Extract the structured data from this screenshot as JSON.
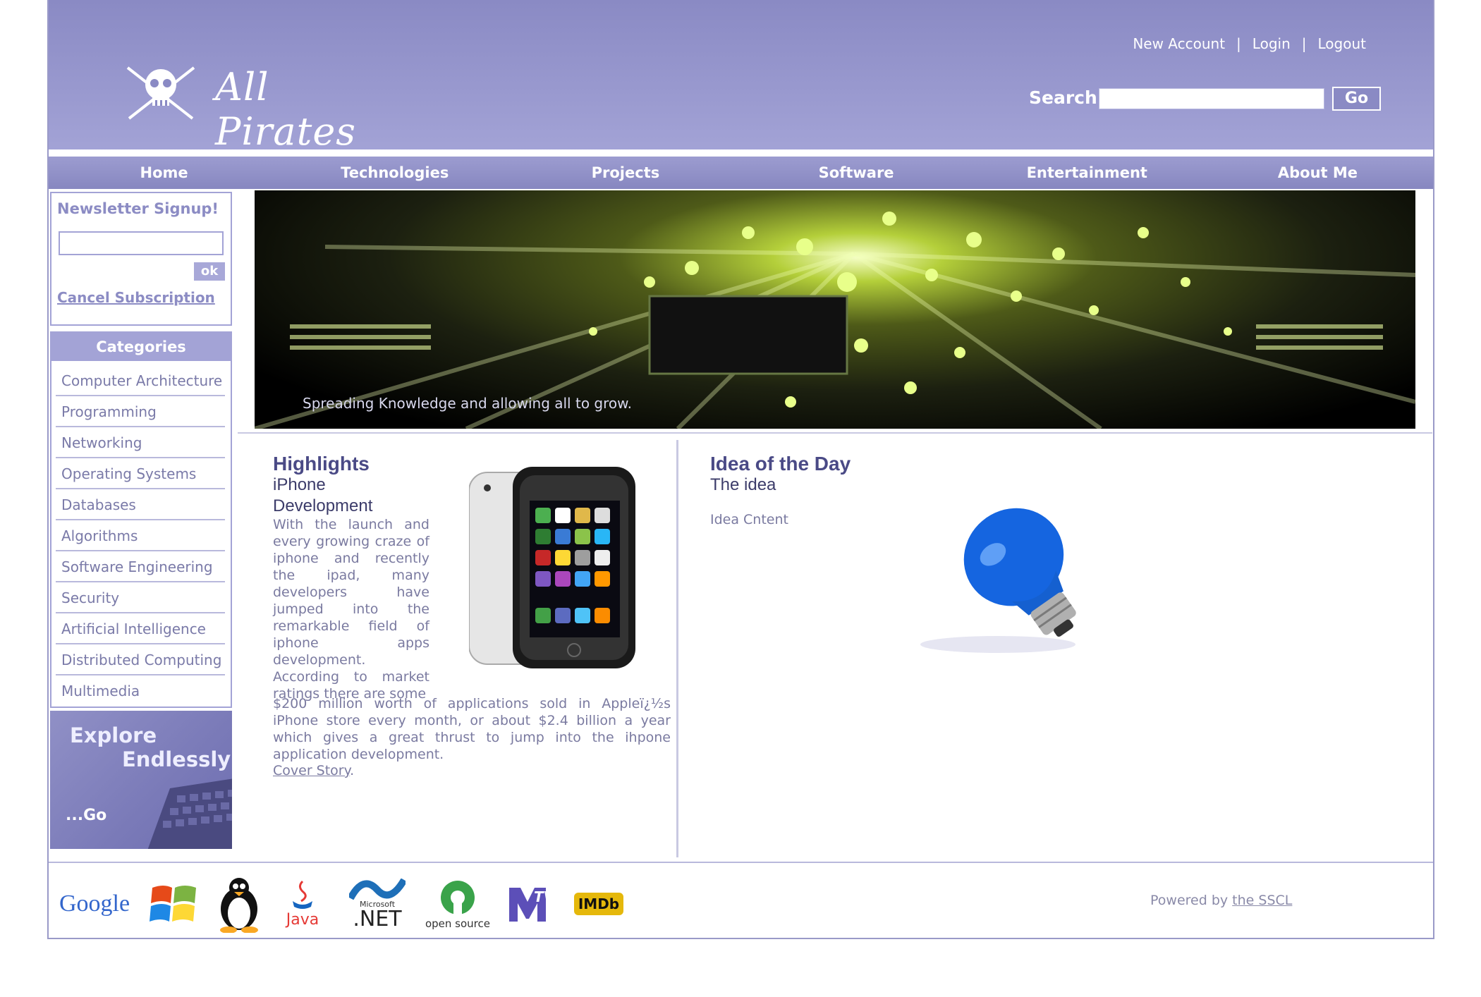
{
  "header": {
    "logo_text": "All Pirates",
    "top_links": [
      "New Account",
      "Login",
      "Logout"
    ],
    "search_label": "Search:",
    "search_button": "Go",
    "colors": {
      "header": "#8a8ac4",
      "nav": "#9c9cd0",
      "accent": "#a3a3d6"
    }
  },
  "nav": {
    "items": [
      "Home",
      "Technologies",
      "Projects",
      "Software",
      "Entertainment",
      "About Me"
    ]
  },
  "newsletter": {
    "title": "Newsletter Signup!",
    "ok": "ok",
    "cancel": "Cancel Subscription"
  },
  "categories": {
    "title": "Categories",
    "items": [
      "Computer Architecture",
      "Programming",
      "Networking",
      "Operating Systems",
      "Databases",
      "Algorithms",
      "Software Engineering",
      "Security",
      "Artificial Intelligence",
      "Distributed Computing",
      "Multimedia"
    ]
  },
  "explore": {
    "line1": "Explore",
    "line2": "Endlessly",
    "go": "...Go"
  },
  "banner": {
    "caption": "Spreading Knowledge and allowing all to grow."
  },
  "highlights": {
    "title": "Highlights",
    "subtitle1": "iPhone",
    "subtitle2": "Development",
    "body1": "With the launch and every growing craze of iphone and recently the ipad, many developers have jumped into the remarkable field of iphone apps development. According to market ratings there are some",
    "body2": "$200 million worth of applications sold in Appleï¿½s iPhone store every month, or about $2.4 billion a year which gives a great thrust to jump into the ihpone application development.",
    "cover_link": "Cover Story",
    "cover_period": "."
  },
  "idea": {
    "title": "Idea of the Day",
    "subtitle": "The idea",
    "content": "Idea Cntent"
  },
  "footer": {
    "logos": [
      "google-logo",
      "windows-logo",
      "linux-logo",
      "java-logo",
      "dotnet-logo",
      "open-source-logo",
      "mtv-logo",
      "imdb-logo"
    ],
    "logo_text": {
      "google": "Google",
      "java": "Java",
      "microsoft": "Microsoft",
      "net": ".NET",
      "open_source": "open source",
      "mtv": "TV",
      "imdb": "IMDb"
    },
    "powered_prefix": "Powered by ",
    "powered_link": "the SSCL"
  }
}
